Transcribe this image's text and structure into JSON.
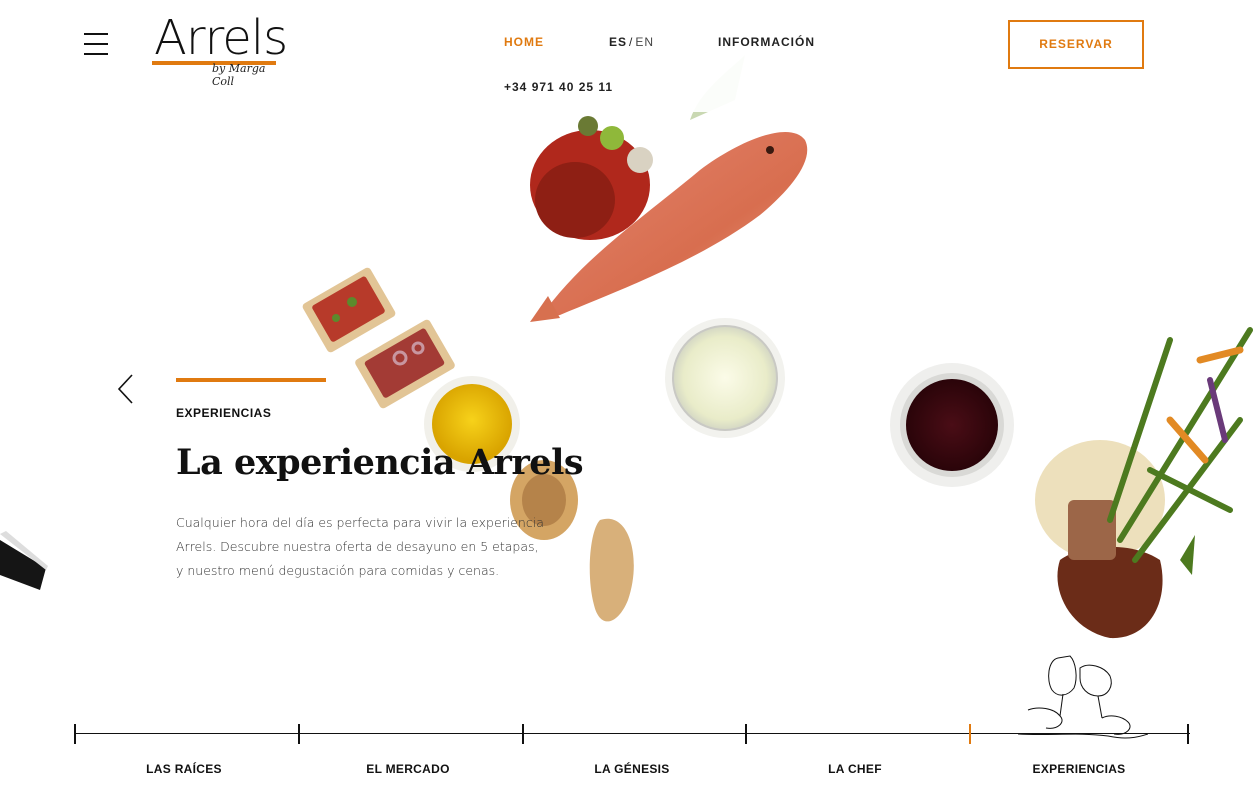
{
  "header": {
    "brand": "Arrels",
    "brand_sub": "by Marga Coll",
    "nav_home": "HOME",
    "lang_es": "ES",
    "lang_sep": "/",
    "lang_en": "EN",
    "nav_info": "INFORMACIÓN",
    "phone": "+34 971 40 25 11",
    "reserve_label": "RESERVAR"
  },
  "hero": {
    "eyebrow": "EXPERIENCIAS",
    "title": "La experiencia Arrels",
    "description": "Cualquier hora del día es perfecta para vivir la experiencia Arrels. Descubre nuestra oferta de desayuno en 5 etapas, y nuestro menú degustación para comidas y cenas."
  },
  "timeline": {
    "items": [
      {
        "label": "LAS RAÍCES"
      },
      {
        "label": "EL MERCADO"
      },
      {
        "label": "LA GÉNESIS"
      },
      {
        "label": "LA CHEF"
      },
      {
        "label": "EXPERIENCIAS"
      }
    ],
    "active_index": 4
  },
  "colors": {
    "accent": "#e07a10",
    "text": "#111111",
    "background": "#ffffff"
  },
  "icons": {
    "menu": "hamburger-menu-icon",
    "prev": "chevron-left-icon",
    "toast": "wine-toast-illustration"
  }
}
